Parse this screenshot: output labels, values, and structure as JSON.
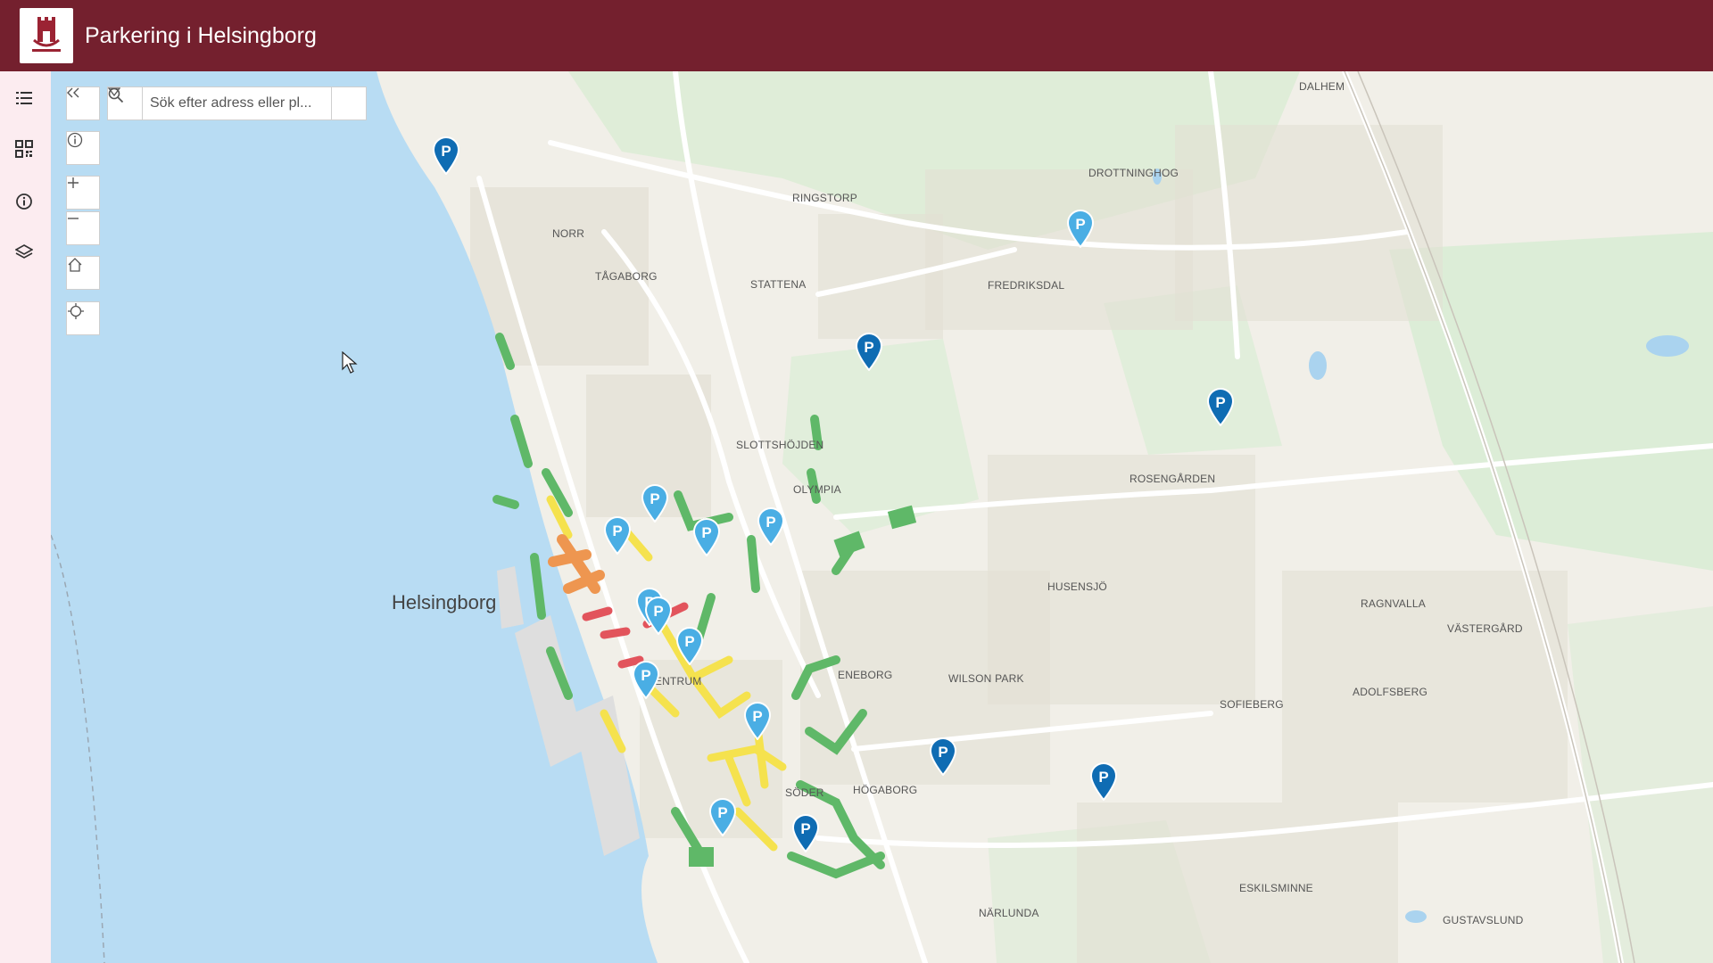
{
  "app": {
    "title": "Parkering i Helsingborg"
  },
  "colors": {
    "header": "#74202e",
    "sidebar": "#fcecf0",
    "water": "#b8dcf3",
    "pin_dark": "#0f6cb3",
    "pin_light": "#4aaee4",
    "zone_green": "#5fb868",
    "zone_yellow": "#f5e24e",
    "zone_orange": "#ee9650",
    "zone_red": "#e2545c"
  },
  "sidebar": {
    "items": [
      {
        "icon": "list-icon"
      },
      {
        "icon": "qr-code-icon"
      },
      {
        "icon": "info-icon"
      },
      {
        "icon": "layers-icon"
      }
    ]
  },
  "search": {
    "placeholder": "Sök efter adress eller pl..."
  },
  "map_controls": [
    "collapse",
    "info",
    "zoom-in",
    "zoom-out",
    "home",
    "locate"
  ],
  "city_label": "Helsingborg",
  "places": [
    {
      "id": "dalhem",
      "name": "DALHEM"
    },
    {
      "id": "drottninghog",
      "name": "DROTTNINGHOG"
    },
    {
      "id": "ringstorp",
      "name": "RINGSTORP"
    },
    {
      "id": "norr",
      "name": "NORR"
    },
    {
      "id": "tagaborg",
      "name": "TÅGABORG"
    },
    {
      "id": "stattena",
      "name": "STATTENA"
    },
    {
      "id": "fredriksdal",
      "name": "FREDRIKSDAL"
    },
    {
      "id": "slottshojden",
      "name": "SLOTTSHÖJDEN"
    },
    {
      "id": "olympia",
      "name": "OLYMPIA"
    },
    {
      "id": "rosengarden",
      "name": "ROSENGÅRDEN"
    },
    {
      "id": "husensjo",
      "name": "HUSENSJÖ"
    },
    {
      "id": "ragnvalla",
      "name": "RAGNVALLA"
    },
    {
      "id": "vastergard",
      "name": "VÄSTERGÅRD"
    },
    {
      "id": "centrum",
      "name": "CENTRUM"
    },
    {
      "id": "eneborg",
      "name": "ENEBORG"
    },
    {
      "id": "wilsonpark",
      "name": "WILSON PARK"
    },
    {
      "id": "adolfsberg",
      "name": "ADOLFSBERG"
    },
    {
      "id": "sofieberg",
      "name": "SOFIEBERG"
    },
    {
      "id": "soder",
      "name": "SÖDER"
    },
    {
      "id": "hogaborg",
      "name": "HÖGABORG"
    },
    {
      "id": "eskilsminne",
      "name": "ESKILSMINNE"
    },
    {
      "id": "narlunda",
      "name": "NÄRLUNDA"
    },
    {
      "id": "gustavslund",
      "name": "GUSTAVSLUND"
    }
  ],
  "parking_pins": [
    {
      "icon": "parking-pin-icon",
      "style": "dark"
    },
    {
      "icon": "parking-pin-icon",
      "style": "light"
    },
    {
      "icon": "parking-pin-icon",
      "style": "dark"
    },
    {
      "icon": "parking-pin-icon",
      "style": "dark"
    },
    {
      "icon": "parking-pin-icon",
      "style": "light"
    },
    {
      "icon": "parking-pin-icon",
      "style": "light"
    },
    {
      "icon": "parking-pin-icon",
      "style": "light"
    },
    {
      "icon": "parking-pin-icon",
      "style": "light"
    },
    {
      "icon": "parking-pin-icon",
      "style": "light"
    },
    {
      "icon": "parking-pin-icon",
      "style": "light"
    },
    {
      "icon": "parking-pin-icon",
      "style": "light"
    },
    {
      "icon": "parking-pin-icon",
      "style": "light"
    },
    {
      "icon": "parking-pin-icon",
      "style": "light"
    },
    {
      "icon": "parking-pin-icon",
      "style": "light"
    },
    {
      "icon": "parking-pin-icon",
      "style": "dark"
    },
    {
      "icon": "parking-pin-icon",
      "style": "dark"
    },
    {
      "icon": "parking-pin-icon",
      "style": "dark"
    }
  ]
}
